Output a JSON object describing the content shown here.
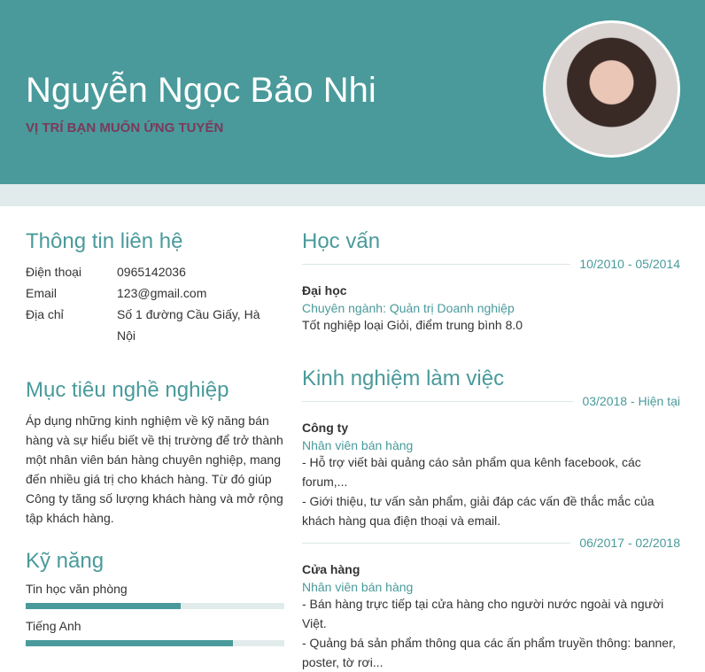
{
  "header": {
    "name": "Nguyễn Ngọc Bảo Nhi",
    "position": "VỊ TRÍ BẠN MUỐN ỨNG TUYỂN",
    "accent": "#4a9a9b"
  },
  "contact": {
    "title": "Thông tin liên hệ",
    "items": [
      {
        "label": "Điện thoại",
        "value": "0965142036"
      },
      {
        "label": "Email",
        "value": "123@gmail.com"
      },
      {
        "label": "Địa chỉ",
        "value": "Số 1 đường Cầu Giấy, Hà Nội"
      }
    ]
  },
  "objective": {
    "title": "Mục tiêu nghề nghiệp",
    "text": "Áp dụng những kinh nghiệm về kỹ năng bán hàng và sự hiểu biết về thị trường để trở thành một nhân viên bán hàng chuyên nghiệp, mang đến nhiều giá trị cho khách hàng. Từ đó giúp Công ty tăng số lượng khách hàng và mở rộng tập khách hàng."
  },
  "skills": {
    "title": "Kỹ năng",
    "items": [
      {
        "name": "Tin học văn phòng",
        "level": 60
      },
      {
        "name": "Tiếng Anh",
        "level": 80
      }
    ]
  },
  "education": {
    "title": "Học vấn",
    "date": "10/2010 - 05/2014",
    "school": "Đại học",
    "major": "Chuyên ngành: Quản trị Doanh nghiệp",
    "detail": "Tốt nghiệp loại Giỏi, điểm trung bình 8.0"
  },
  "experience": {
    "title": "Kinh nghiệm làm việc",
    "items": [
      {
        "date": "03/2018 - Hiện tại",
        "company": "Công ty",
        "role": "Nhân viên bán hàng",
        "lines": [
          "- Hỗ trợ viết bài quảng cáo sản phẩm qua kênh facebook, các forum,...",
          "- Giới thiệu, tư vấn sản phẩm, giải đáp các vấn đề thắc mắc của khách hàng qua điện thoại và email."
        ]
      },
      {
        "date": "06/2017 - 02/2018",
        "company": "Cửa hàng",
        "role": "Nhân viên bán hàng",
        "lines": [
          "- Bán hàng trực tiếp tại cửa hàng cho người nước ngoài và người Việt.",
          "- Quảng bá sản phẩm thông qua các ấn phẩm truyền thông: banner, poster, tờ rơi..."
        ]
      }
    ]
  }
}
